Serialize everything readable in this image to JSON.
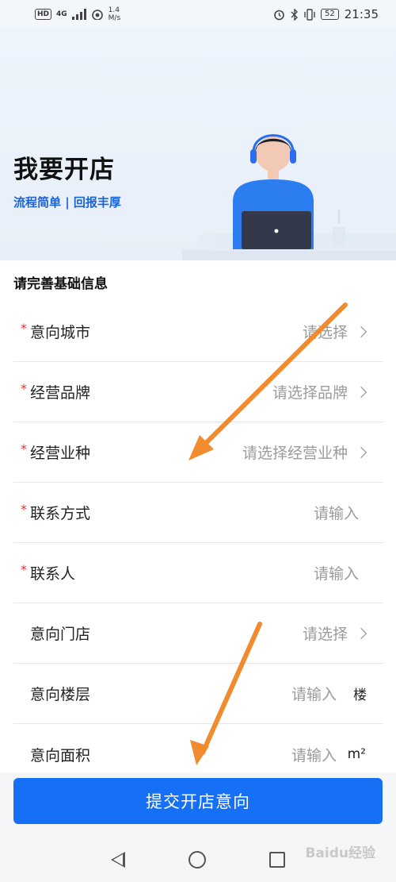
{
  "status_bar": {
    "hd": "HD",
    "network": "4G",
    "speed_value": "1.4",
    "speed_unit": "M/s",
    "battery": "52",
    "time": "21:35"
  },
  "banner": {
    "title": "我要开店",
    "subtitle": "流程简单 | 回报丰厚"
  },
  "form": {
    "section_title": "请完善基础信息",
    "rows": [
      {
        "label": "意向城市",
        "placeholder": "请选择",
        "required": "*"
      },
      {
        "label": "经营品牌",
        "placeholder": "请选择品牌",
        "required": "*"
      },
      {
        "label": "经营业种",
        "placeholder": "请选择经营业种",
        "required": "*"
      },
      {
        "label": "联系方式",
        "placeholder": "请输入",
        "required": "*"
      },
      {
        "label": "联系人",
        "placeholder": "请输入",
        "required": "*"
      },
      {
        "label": "意向门店",
        "placeholder": "请选择"
      },
      {
        "label": "意向楼层",
        "placeholder": "请输入",
        "unit": "楼"
      },
      {
        "label": "意向面积",
        "placeholder": "请输入",
        "unit": "m²"
      }
    ]
  },
  "submit_label": "提交开店意向",
  "watermark": "Baidu经验",
  "colors": {
    "accent": "#1670f6",
    "subtitle": "#1a63d8",
    "required": "#dd3333",
    "annotation_arrow": "#f28a2e"
  },
  "icons": [
    "hd-badge",
    "signal-icon",
    "wifi-icon",
    "alarm-icon",
    "bluetooth-icon",
    "vibrate-icon",
    "battery-icon",
    "chevron-right-icon",
    "back-icon",
    "home-icon",
    "recent-apps-icon",
    "annotation-arrow-icon"
  ]
}
